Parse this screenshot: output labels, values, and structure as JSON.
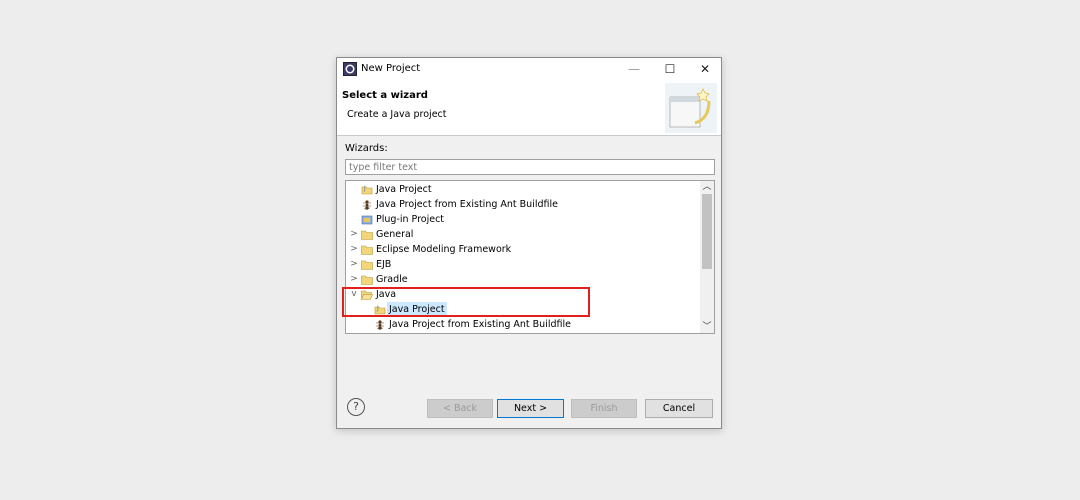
{
  "window": {
    "title": "New Project",
    "min_glyph": "—",
    "max_glyph": "☐",
    "close_glyph": "✕"
  },
  "header": {
    "title": "Select a wizard",
    "description": "Create a Java project"
  },
  "wizards_label": "Wizards:",
  "filter": {
    "placeholder": "type filter text",
    "value": ""
  },
  "tree": [
    {
      "label": "Java Project",
      "icon": "java-project-icon",
      "expander": ""
    },
    {
      "label": "Java Project from Existing Ant Buildfile",
      "icon": "ant-icon",
      "expander": ""
    },
    {
      "label": "Plug-in Project",
      "icon": "plugin-icon",
      "expander": ""
    },
    {
      "label": "General",
      "icon": "folder-icon",
      "expander": ">"
    },
    {
      "label": "Eclipse Modeling Framework",
      "icon": "folder-icon",
      "expander": ">"
    },
    {
      "label": "EJB",
      "icon": "folder-icon",
      "expander": ">"
    },
    {
      "label": "Gradle",
      "icon": "folder-icon",
      "expander": ">"
    },
    {
      "label": "Java",
      "icon": "folder-open-icon",
      "expander": "v"
    },
    {
      "label": "Java Project",
      "icon": "java-project-icon",
      "expander": "",
      "selected": true
    },
    {
      "label": "Java Project from Existing Ant Buildfile",
      "icon": "ant-icon",
      "expander": ""
    }
  ],
  "buttons": {
    "help": "?",
    "back": "< Back",
    "next": "Next >",
    "finish": "Finish",
    "cancel": "Cancel"
  },
  "colors": {
    "highlight": "#e0201c",
    "selection": "#cce8ff",
    "default_button_border": "#0078d7"
  }
}
